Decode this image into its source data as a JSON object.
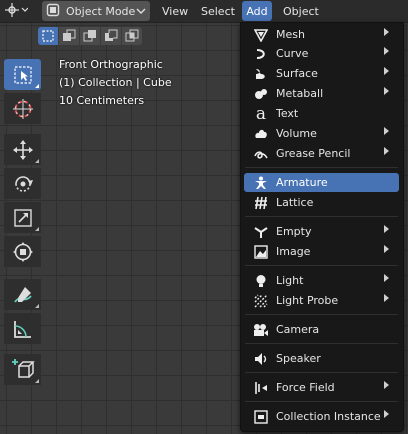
{
  "header": {
    "mode": "Object Mode",
    "menus": {
      "view": "View",
      "select": "Select",
      "add": "Add",
      "object": "Object"
    }
  },
  "viewport": {
    "view_name": "Front Orthographic",
    "collection": "(1) Collection | Cube",
    "scale": "10 Centimeters"
  },
  "add_menu": {
    "mesh": "Mesh",
    "curve": "Curve",
    "surface": "Surface",
    "metaball": "Metaball",
    "text": "Text",
    "volume": "Volume",
    "grease_pencil": "Grease Pencil",
    "armature": "Armature",
    "lattice": "Lattice",
    "empty": "Empty",
    "image": "Image",
    "light": "Light",
    "light_probe": "Light Probe",
    "camera": "Camera",
    "speaker": "Speaker",
    "force_field": "Force Field",
    "collection_instance": "Collection Instance"
  },
  "colors": {
    "accent": "#4772b3",
    "menu_bg": "#181818",
    "header_bg": "#2b2b2b"
  }
}
